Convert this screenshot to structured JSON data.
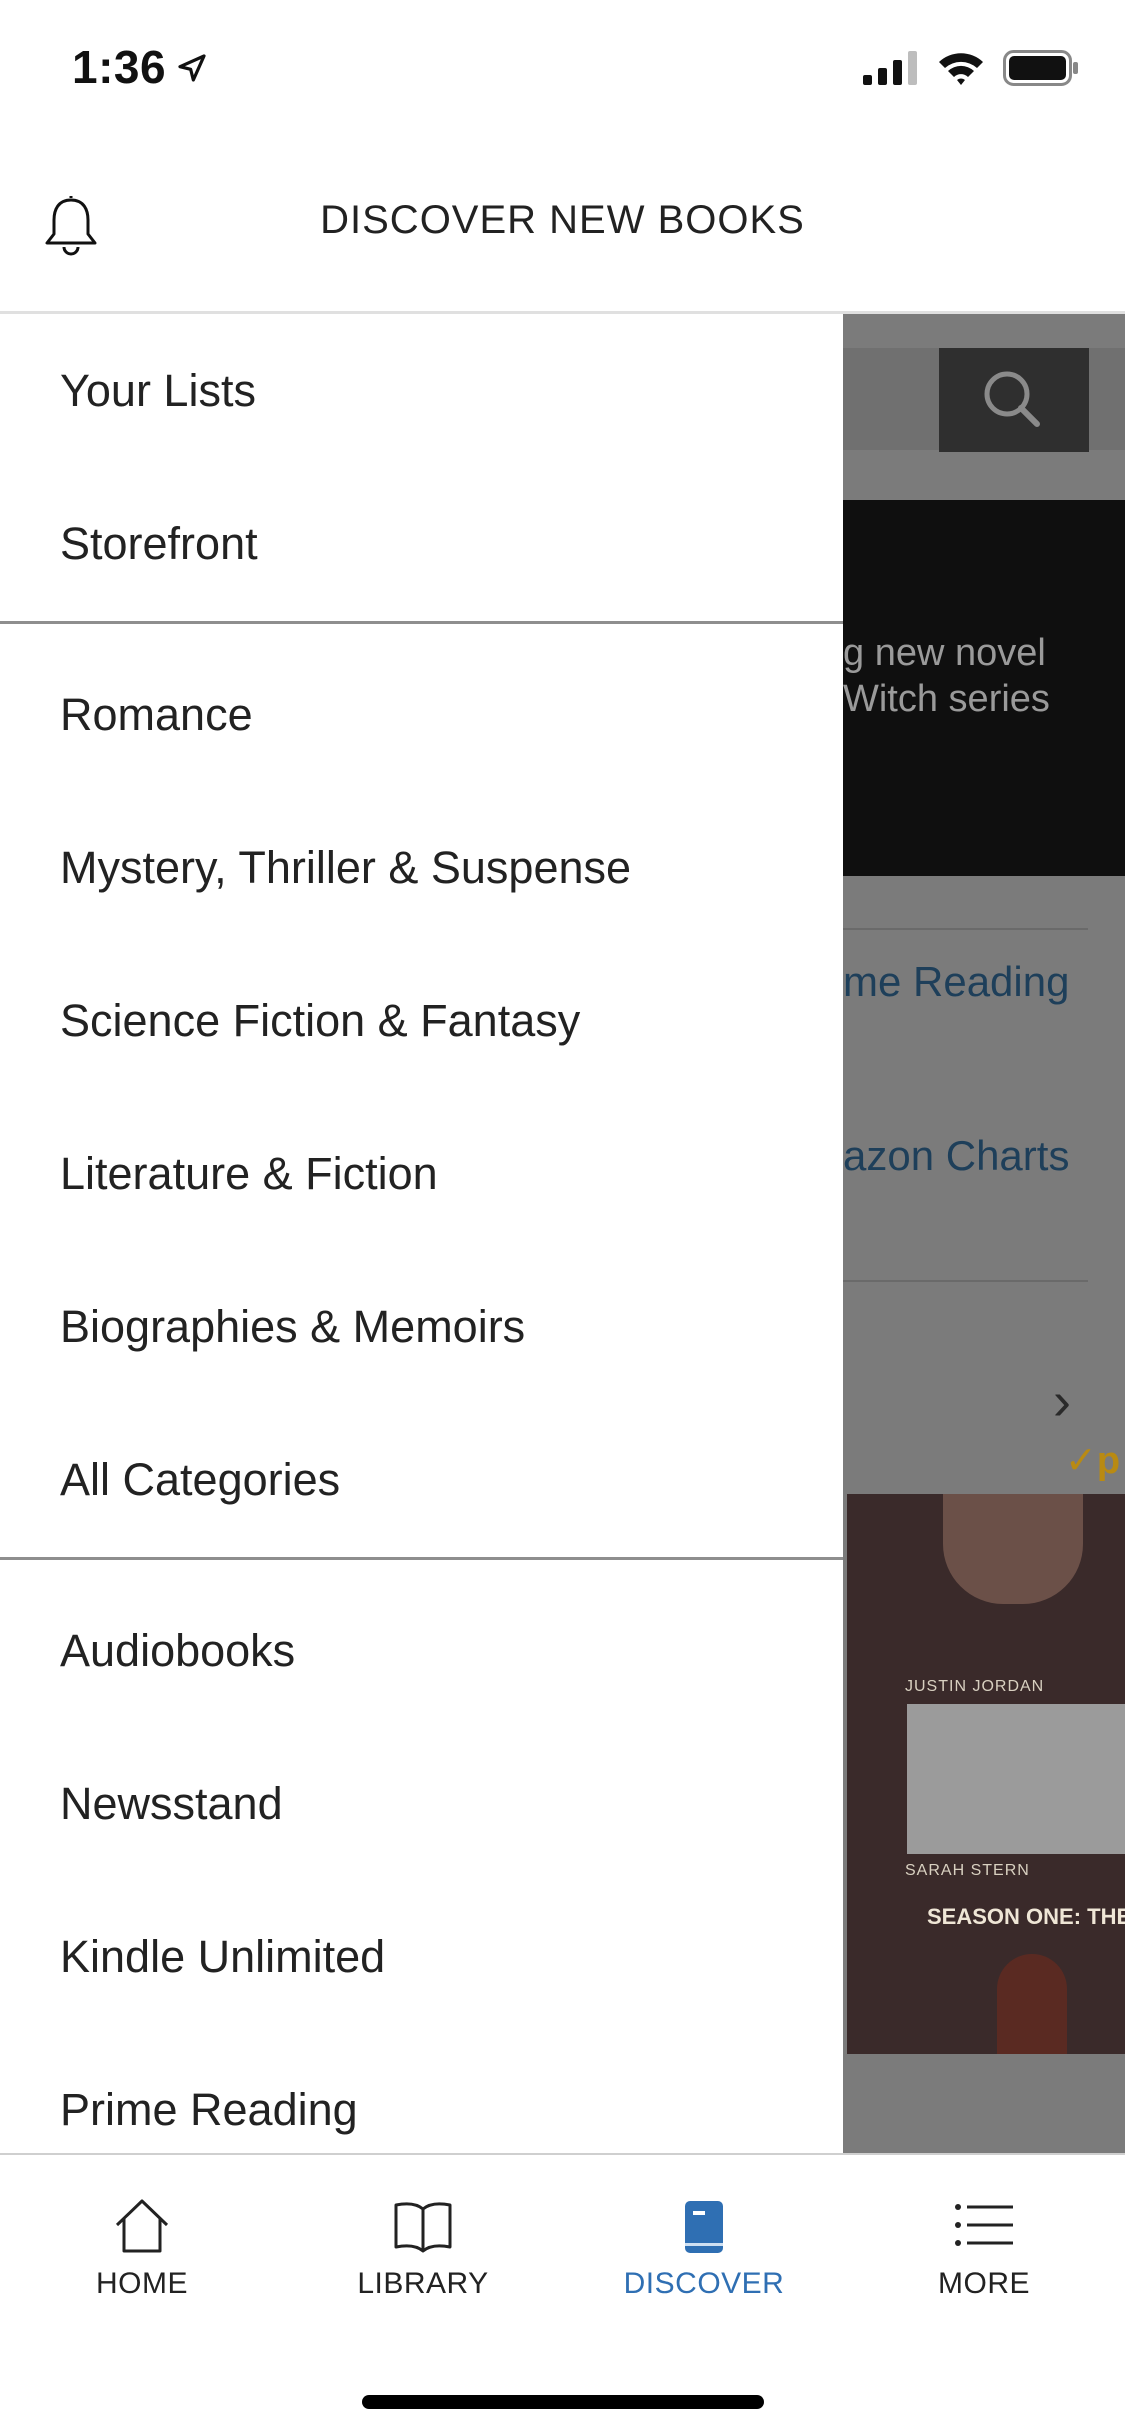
{
  "status_bar": {
    "time": "1:36",
    "icons": [
      "location-arrow-icon",
      "signal-icon",
      "wifi-icon",
      "battery-icon"
    ]
  },
  "header": {
    "title": "DISCOVER NEW BOOKS",
    "icon": "bell-icon"
  },
  "drawer": {
    "items": [
      "Your Lists",
      "Storefront",
      "Romance",
      "Mystery, Thriller & Suspense",
      "Science Fiction & Fantasy",
      "Literature & Fiction",
      "Biographies & Memoirs",
      "All Categories",
      "Audiobooks",
      "Newsstand",
      "Kindle Unlimited",
      "Prime Reading"
    ]
  },
  "background": {
    "banner_text": "g new novel\nWitch series",
    "link_1": "me Reading",
    "link_2": "azon Charts",
    "prime_badge": "✓p",
    "book": {
      "author": "JUSTIN JORDAN",
      "author2": "SARAH STERN",
      "subtitle": "SEASON ONE: THE CHASE"
    }
  },
  "tabs": [
    {
      "label": "HOME",
      "icon": "home-icon",
      "active": false
    },
    {
      "label": "LIBRARY",
      "icon": "book-open-icon",
      "active": false
    },
    {
      "label": "DISCOVER",
      "icon": "discover-book-icon",
      "active": true
    },
    {
      "label": "MORE",
      "icon": "list-menu-icon",
      "active": false
    }
  ],
  "colors": {
    "accent": "#2f6fb3",
    "overlay": "#7b7b7b",
    "link_dimmed": "#1e3f5a"
  }
}
